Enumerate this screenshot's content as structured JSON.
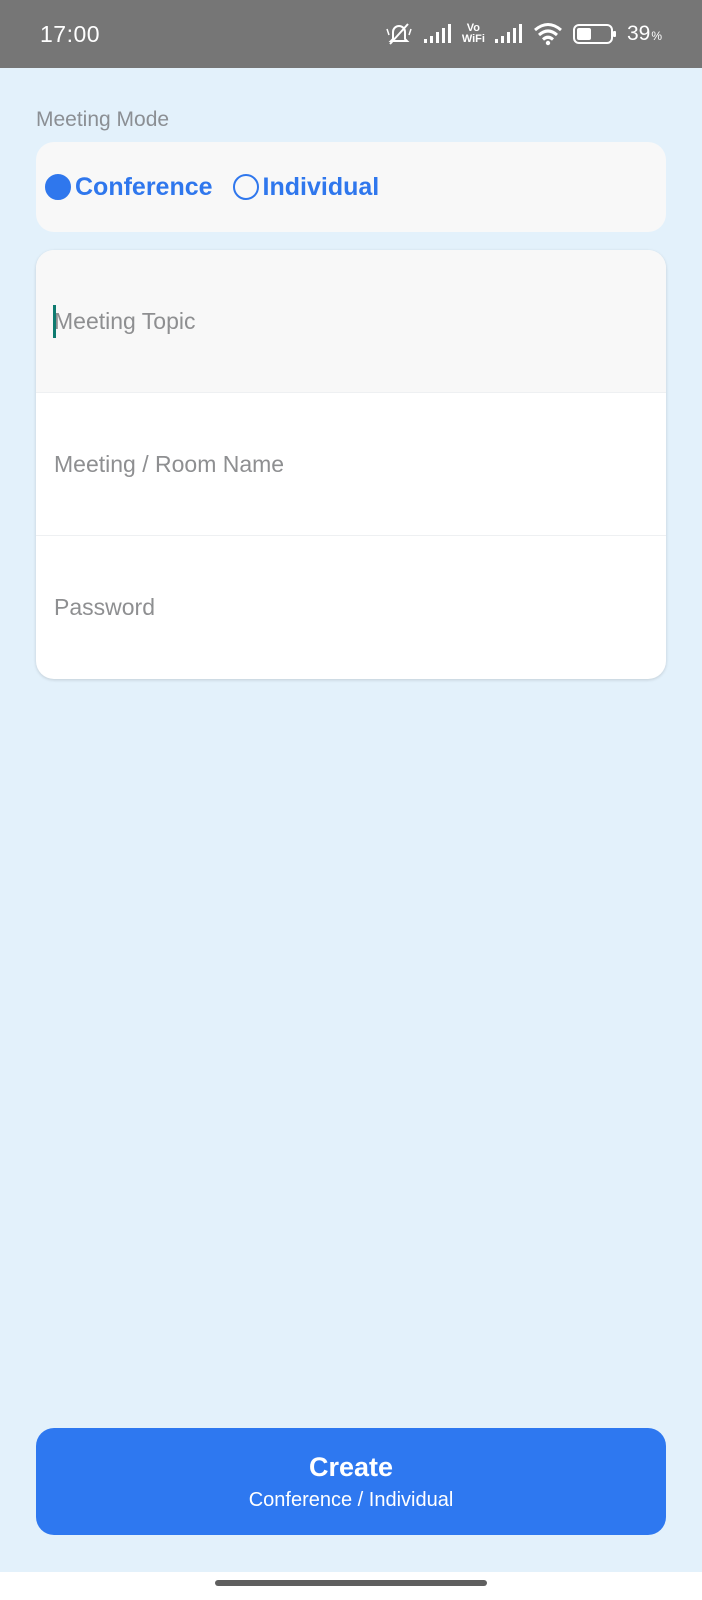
{
  "status_bar": {
    "time": "17:00",
    "vo_top": "Vo",
    "vo_bottom": "WiFi",
    "battery_percent": "39",
    "battery_unit": "%",
    "icons": [
      "mute-bell-icon",
      "signal-icon",
      "vowifi-icon",
      "signal-icon",
      "wifi-icon",
      "battery-icon"
    ]
  },
  "meeting_mode": {
    "label": "Meeting Mode",
    "options": [
      {
        "label": "Conference",
        "selected": true
      },
      {
        "label": "Individual",
        "selected": false
      }
    ]
  },
  "form": {
    "topic_placeholder": "Meeting Topic",
    "room_placeholder": "Meeting / Room Name",
    "password_placeholder": "Password"
  },
  "create_button": {
    "title": "Create",
    "subtitle": "Conference / Individual"
  },
  "colors": {
    "accent": "#2e78f0",
    "background": "#e3f1fb",
    "status_bar": "#767676"
  }
}
